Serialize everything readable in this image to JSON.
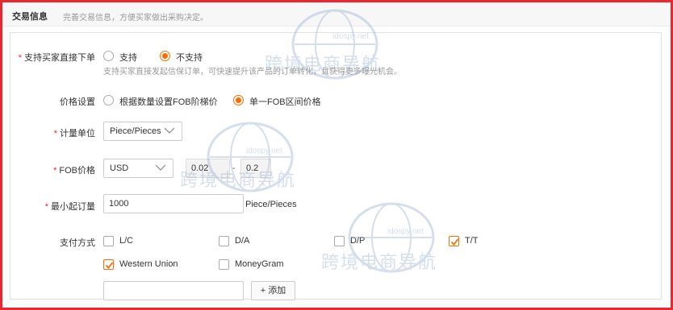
{
  "header": {
    "title": "交易信息",
    "description": "完善交易信息，方便买家做出采购决定。"
  },
  "direct_order": {
    "label": "支持买家直接下单",
    "required_mark": "*",
    "options": [
      "支持",
      "不支持"
    ],
    "selected": "不支持",
    "hint": "支持买家直接发起信保订单，可快速提升该产品的订单转化，且获得更多曝光机会。"
  },
  "price_setting": {
    "label": "价格设置",
    "options": [
      "根据数量设置FOB阶梯价",
      "单一FOB区间价格"
    ],
    "selected": "单一FOB区间价格"
  },
  "unit": {
    "label": "计量单位",
    "required_mark": "*",
    "value": "Piece/Pieces"
  },
  "fob_price": {
    "label": "FOB价格",
    "required_mark": "*",
    "currency": "USD",
    "min": "0.02",
    "max": "0.2",
    "separator": "-"
  },
  "moq": {
    "label": "最小起订量",
    "required_mark": "*",
    "value": "1000",
    "unit": "Piece/Pieces"
  },
  "payment": {
    "label": "支付方式",
    "methods": [
      {
        "name": "L/C",
        "checked": false
      },
      {
        "name": "D/A",
        "checked": false
      },
      {
        "name": "D/P",
        "checked": false
      },
      {
        "name": "T/T",
        "checked": true
      },
      {
        "name": "Western Union",
        "checked": true
      },
      {
        "name": "MoneyGram",
        "checked": false
      }
    ],
    "custom_input": "",
    "add_button": "+ 添加"
  },
  "watermark": {
    "text": "跨境电商导航",
    "site": "idospy.net"
  },
  "colors": {
    "accent": "#ff6a00",
    "required": "#e8272f",
    "frame": "#e8272f"
  }
}
